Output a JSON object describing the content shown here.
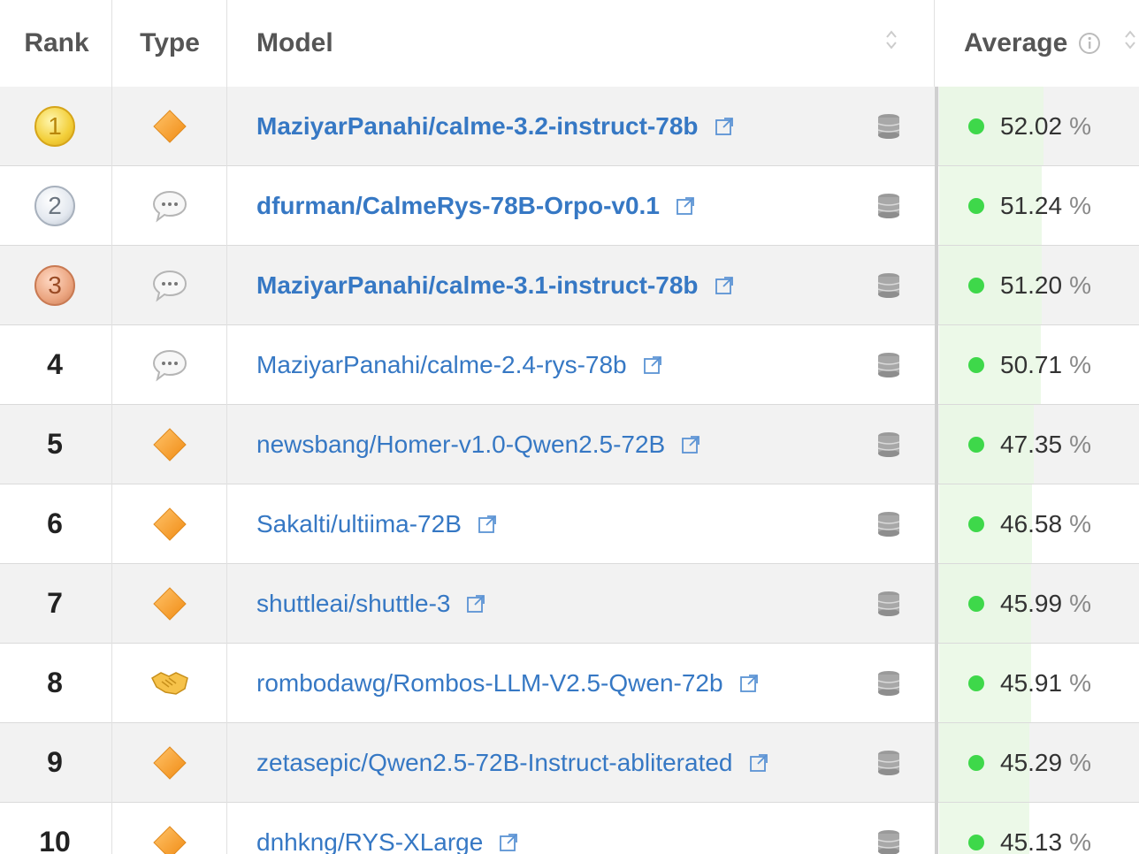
{
  "header": {
    "rank": "Rank",
    "type": "Type",
    "model": "Model",
    "average": "Average"
  },
  "colors": {
    "link": "#3678c4",
    "status_dot": "#3ed84a",
    "row_shade": "#f2f2f2",
    "average_bar": "#e9f8e4"
  },
  "rows": [
    {
      "rank": "1",
      "medal": "gold",
      "type_icon": "diamond-icon",
      "model": "MaziyarPanahi/calme-3.2-instruct-78b",
      "bold": true,
      "average": "52.02",
      "pct": "%",
      "bar_fraction": 0.52
    },
    {
      "rank": "2",
      "medal": "silver",
      "type_icon": "chat-bubble-icon",
      "model": "dfurman/CalmeRys-78B-Orpo-v0.1",
      "bold": true,
      "average": "51.24",
      "pct": "%",
      "bar_fraction": 0.5124
    },
    {
      "rank": "3",
      "medal": "bronze",
      "type_icon": "chat-bubble-icon",
      "model": "MaziyarPanahi/calme-3.1-instruct-78b",
      "bold": true,
      "average": "51.20",
      "pct": "%",
      "bar_fraction": 0.512
    },
    {
      "rank": "4",
      "medal": "",
      "type_icon": "chat-bubble-icon",
      "model": "MaziyarPanahi/calme-2.4-rys-78b",
      "bold": false,
      "average": "50.71",
      "pct": "%",
      "bar_fraction": 0.5071
    },
    {
      "rank": "5",
      "medal": "",
      "type_icon": "diamond-icon",
      "model": "newsbang/Homer-v1.0-Qwen2.5-72B",
      "bold": false,
      "average": "47.35",
      "pct": "%",
      "bar_fraction": 0.4735
    },
    {
      "rank": "6",
      "medal": "",
      "type_icon": "diamond-icon",
      "model": "Sakalti/ultiima-72B",
      "bold": false,
      "average": "46.58",
      "pct": "%",
      "bar_fraction": 0.4658
    },
    {
      "rank": "7",
      "medal": "",
      "type_icon": "diamond-icon",
      "model": "shuttleai/shuttle-3",
      "bold": false,
      "average": "45.99",
      "pct": "%",
      "bar_fraction": 0.4599
    },
    {
      "rank": "8",
      "medal": "",
      "type_icon": "handshake-icon",
      "model": "rombodawg/Rombos-LLM-V2.5-Qwen-72b",
      "bold": false,
      "average": "45.91",
      "pct": "%",
      "bar_fraction": 0.4591
    },
    {
      "rank": "9",
      "medal": "",
      "type_icon": "diamond-icon",
      "model": "zetasepic/Qwen2.5-72B-Instruct-abliterated",
      "bold": false,
      "average": "45.29",
      "pct": "%",
      "bar_fraction": 0.4529
    },
    {
      "rank": "10",
      "medal": "",
      "type_icon": "diamond-icon",
      "model": "dnhkng/RYS-XLarge",
      "bold": false,
      "average": "45.13",
      "pct": "%",
      "bar_fraction": 0.4513
    }
  ]
}
